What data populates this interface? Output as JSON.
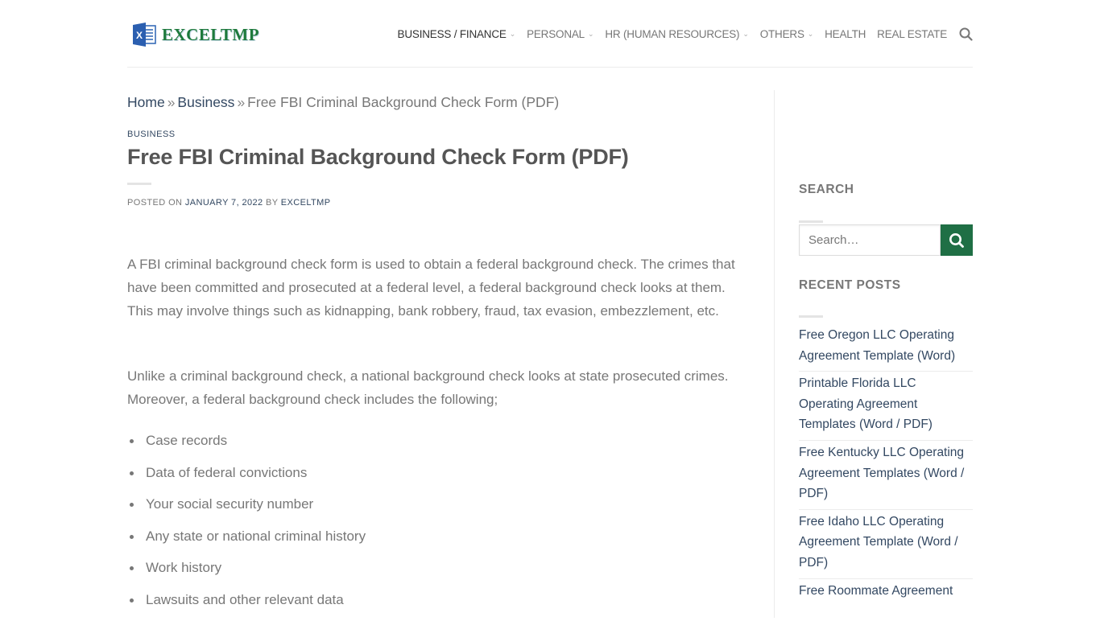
{
  "header": {
    "logo_text": "EXCELTMP",
    "nav": [
      {
        "label": "BUSINESS / FINANCE",
        "dropdown": true,
        "active": true
      },
      {
        "label": "PERSONAL",
        "dropdown": true,
        "active": false
      },
      {
        "label": "HR (HUMAN RESOURCES)",
        "dropdown": true,
        "active": false
      },
      {
        "label": "OTHERS",
        "dropdown": true,
        "active": false
      },
      {
        "label": "HEALTH",
        "dropdown": false,
        "active": false
      },
      {
        "label": "REAL ESTATE",
        "dropdown": false,
        "active": false
      }
    ],
    "search_icon": "search-icon"
  },
  "breadcrumb": {
    "home": "Home",
    "separator": "»",
    "business": "Business",
    "current": "Free FBI Criminal Background Check Form (PDF)"
  },
  "article": {
    "category": "BUSINESS",
    "title": "Free FBI Criminal Background Check Form (PDF)",
    "meta": {
      "posted_on": "POSTED ON",
      "date": "JANUARY 7, 2022",
      "by": "BY",
      "author": "EXCELTMP"
    },
    "paragraphs": [
      "A FBI criminal background check form is used to obtain a federal background check. The crimes that have been committed and prosecuted at a federal level, a federal background check looks at them. This may involve things such as kidnapping, bank robbery, fraud, tax evasion, embezzlement, etc.",
      "Unlike a criminal background check, a national background check looks at state prosecuted crimes. Moreover, a federal background check includes the following;"
    ],
    "list": [
      "Case records",
      "Data of federal convictions",
      "Your social security number",
      "Any state or national criminal history",
      "Work history",
      "Lawsuits and other relevant data"
    ]
  },
  "sidebar": {
    "search_title": "SEARCH",
    "search_placeholder": "Search…",
    "recent_title": "RECENT POSTS",
    "recent_posts": [
      "Free Oregon LLC Operating Agreement Template (Word)",
      "Printable Florida LLC Operating Agreement Templates (Word / PDF)",
      "Free Kentucky LLC Operating Agreement Templates (Word / PDF)",
      "Free Idaho LLC Operating Agreement Template (Word / PDF)",
      "Free Roommate Agreement"
    ]
  },
  "colors": {
    "brand_green": "#1f6f45",
    "link_blue": "#334862",
    "text_gray": "#777777"
  }
}
